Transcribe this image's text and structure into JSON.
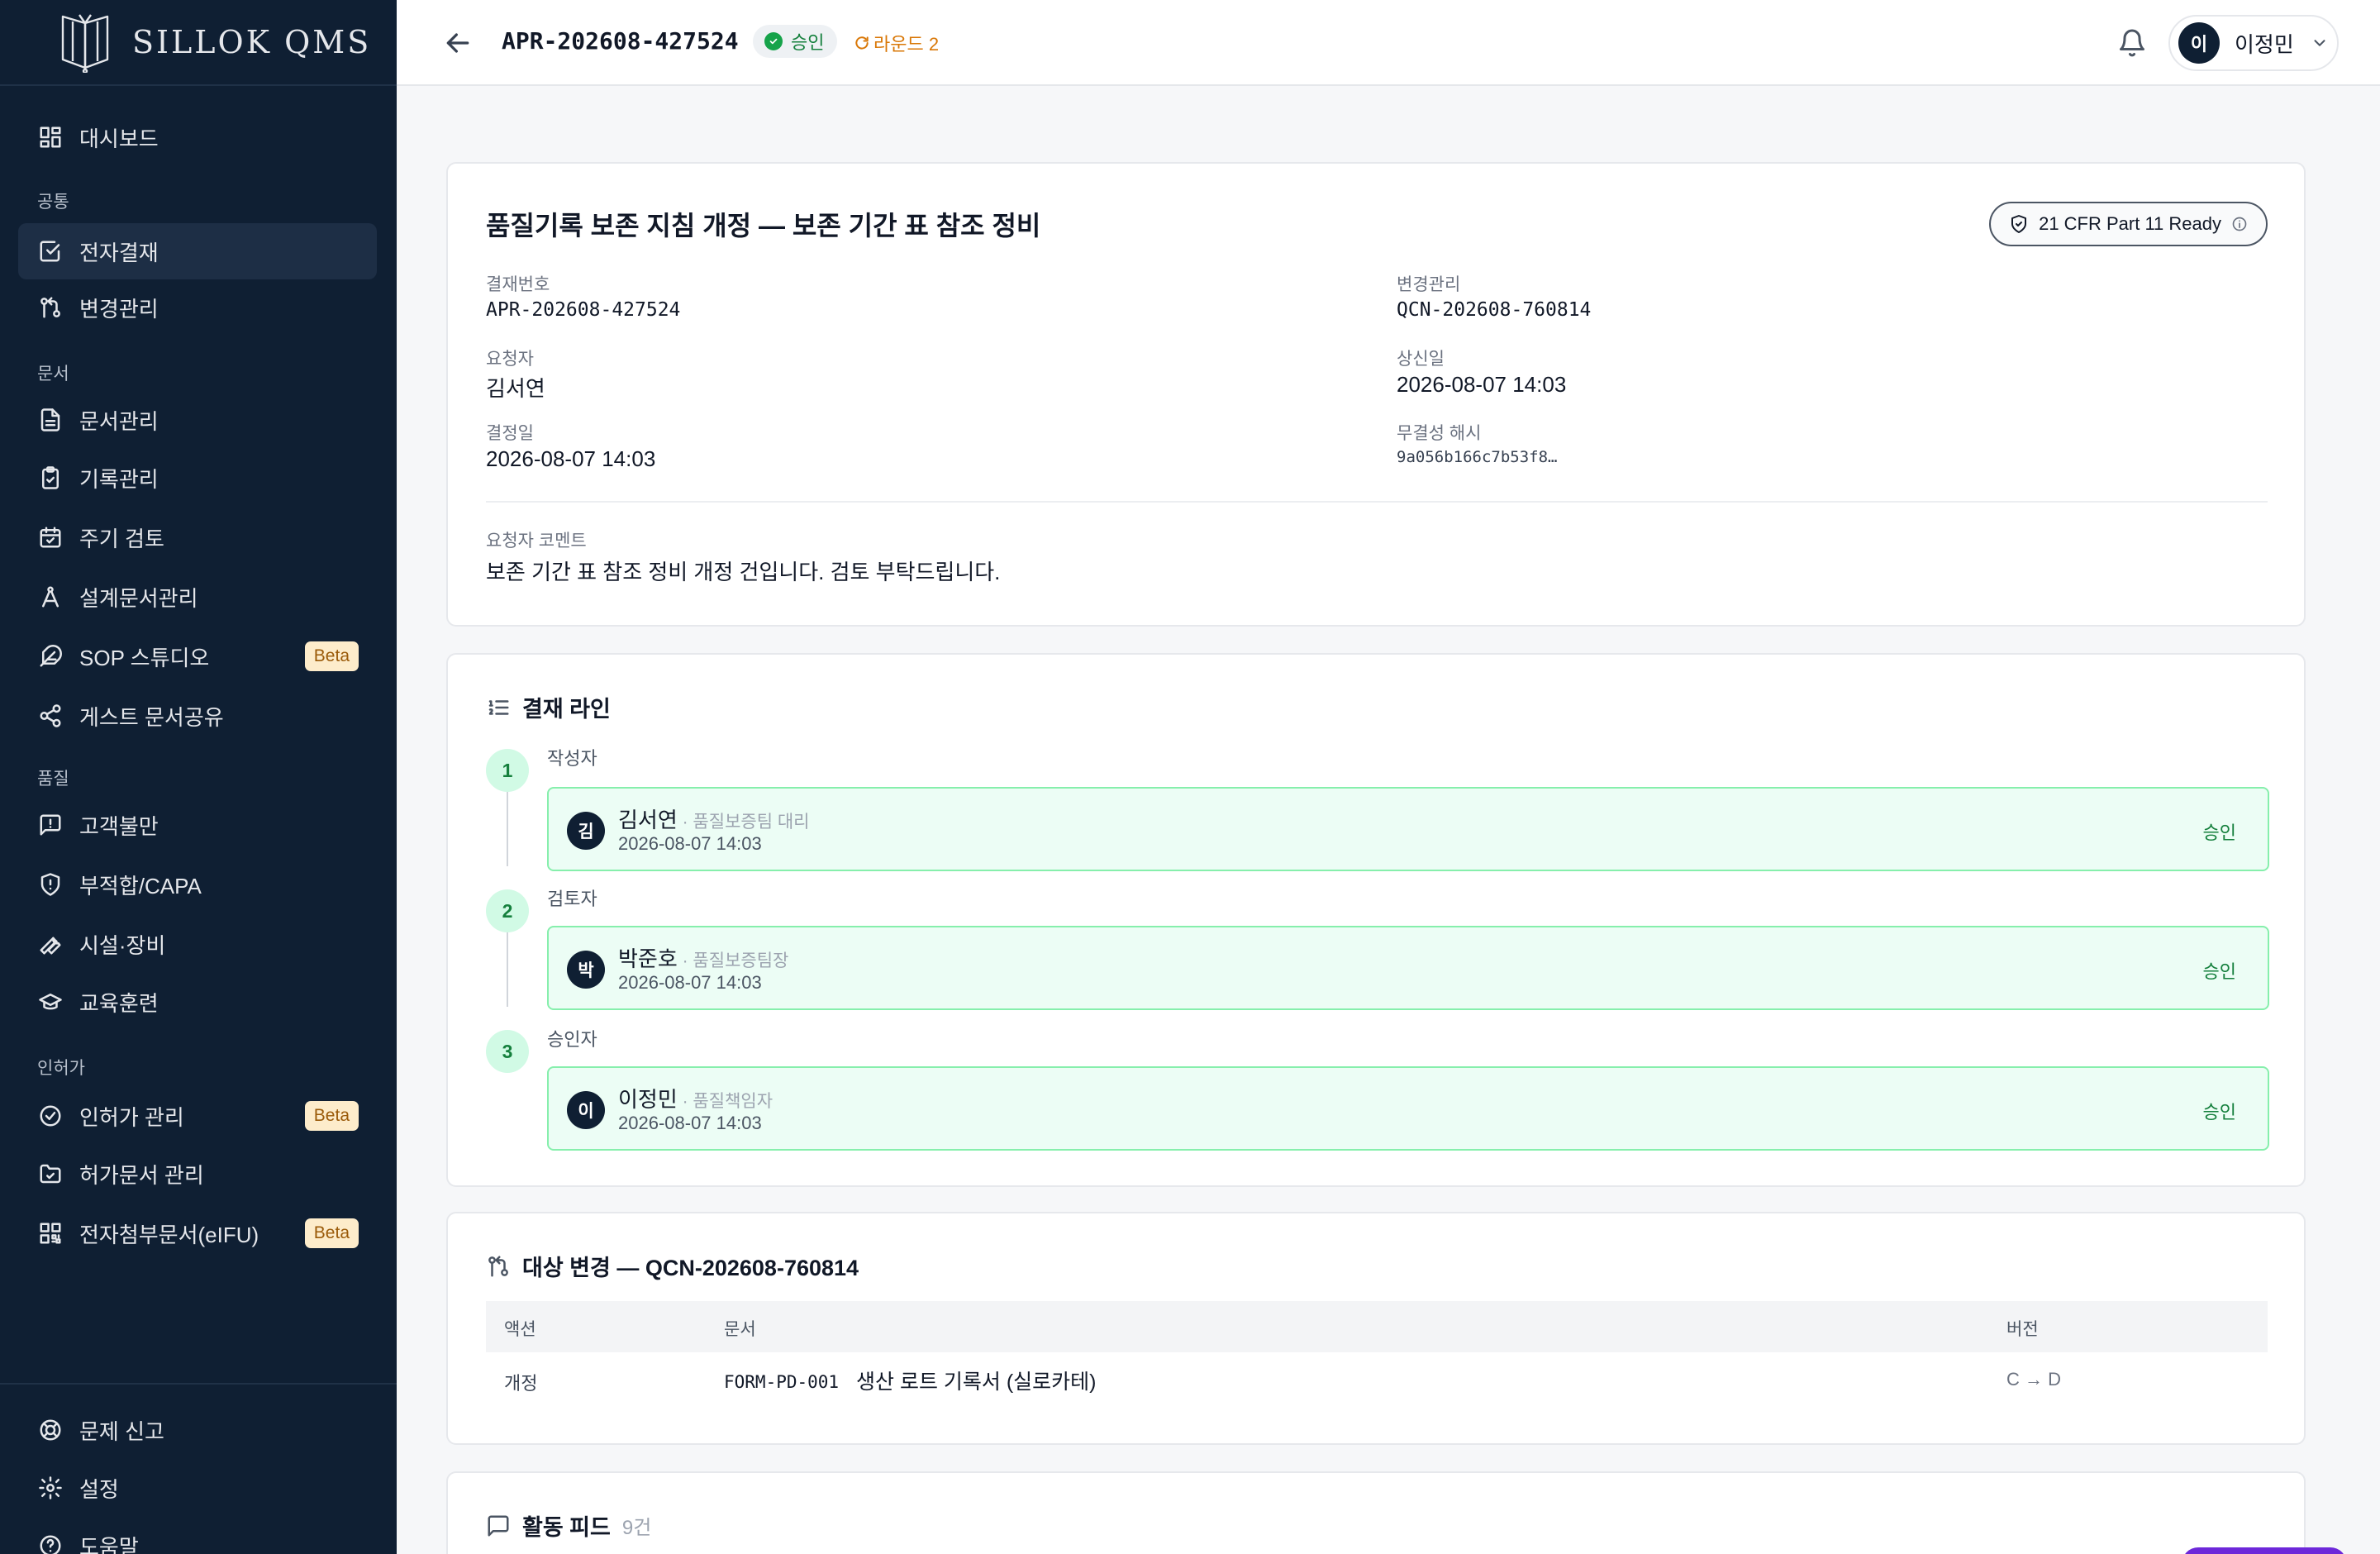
{
  "brand": {
    "name": "SILLOK QMS"
  },
  "sidebar": {
    "items": [
      {
        "id": "dashboard",
        "label": "대시보드",
        "icon": "dashboard-icon"
      },
      {
        "id": "approval",
        "label": "전자결재",
        "icon": "check-square-icon",
        "active": true
      },
      {
        "id": "change",
        "label": "변경관리",
        "icon": "git-compare-icon"
      },
      {
        "id": "docs",
        "label": "문서관리",
        "icon": "file-text-icon"
      },
      {
        "id": "records",
        "label": "기록관리",
        "icon": "clipboard-icon"
      },
      {
        "id": "periodic",
        "label": "주기 검토",
        "icon": "calendar-check-icon"
      },
      {
        "id": "design",
        "label": "설계문서관리",
        "icon": "compass-icon"
      },
      {
        "id": "sop",
        "label": "SOP 스튜디오",
        "icon": "feather-icon",
        "badge": "Beta"
      },
      {
        "id": "guest",
        "label": "게스트 문서공유",
        "icon": "share-icon"
      },
      {
        "id": "complaint",
        "label": "고객불만",
        "icon": "message-alert-icon"
      },
      {
        "id": "capa",
        "label": "부적합/CAPA",
        "icon": "shield-alert-icon"
      },
      {
        "id": "facility",
        "label": "시설·장비",
        "icon": "wrench-icon"
      },
      {
        "id": "training",
        "label": "교육훈련",
        "icon": "graduation-cap-icon"
      },
      {
        "id": "license",
        "label": "인허가 관리",
        "icon": "badge-check-icon",
        "badge": "Beta"
      },
      {
        "id": "permit-docs",
        "label": "허가문서 관리",
        "icon": "folder-check-icon"
      },
      {
        "id": "eifu",
        "label": "전자첨부문서(eIFU)",
        "icon": "qr-code-icon",
        "badge": "Beta"
      }
    ],
    "sections": [
      "공통",
      "문서",
      "품질",
      "인허가"
    ],
    "footer_items": [
      {
        "id": "report",
        "label": "문제 신고",
        "icon": "lifebuoy-icon"
      },
      {
        "id": "settings",
        "label": "설정",
        "icon": "gear-icon"
      },
      {
        "id": "help",
        "label": "도움말",
        "icon": "help-circle-icon"
      }
    ]
  },
  "header": {
    "doc_id": "APR-202608-427524",
    "status": "승인",
    "round": "라운드 2",
    "user": {
      "initial": "이",
      "name": "이정민"
    }
  },
  "summary": {
    "title": "품질기록 보존 지침 개정 — 보존 기간 표 참조 정비",
    "compliance_badge": "21 CFR Part 11 Ready",
    "fields": {
      "approval_no_label": "결재번호",
      "approval_no": "APR-202608-427524",
      "change_label": "변경관리",
      "change_no": "QCN-202608-760814",
      "requester_label": "요청자",
      "requester": "김서연",
      "submitted_label": "상신일",
      "submitted": "2026-08-07 14:03",
      "decided_label": "결정일",
      "decided": "2026-08-07 14:03",
      "hash_label": "무결성 해시",
      "hash": "9a056b166c7b53f8…"
    },
    "comment_label": "요청자 코멘트",
    "comment": "보존 기간 표 참조 정비 개정 건입니다. 검토 부탁드립니다."
  },
  "approval_line": {
    "title": "결재 라인",
    "steps": [
      {
        "num": "1",
        "role": "작성자",
        "initial": "김",
        "name": "김서연",
        "dept": " · 품질보증팀 대리",
        "date": "2026-08-07 14:03",
        "status": "승인"
      },
      {
        "num": "2",
        "role": "검토자",
        "initial": "박",
        "name": "박준호",
        "dept": " · 품질보증팀장",
        "date": "2026-08-07 14:03",
        "status": "승인"
      },
      {
        "num": "3",
        "role": "승인자",
        "initial": "이",
        "name": "이정민",
        "dept": " · 품질책임자",
        "date": "2026-08-07 14:03",
        "status": "승인"
      }
    ]
  },
  "changes": {
    "title": "대상 변경 — QCN-202608-760814",
    "columns": [
      "액션",
      "문서",
      "버전"
    ],
    "rows": [
      {
        "action": "개정",
        "doc_code": "FORM-PD-001",
        "doc_title": "생산 로트 기록서 (실로카테)",
        "version": "C → D"
      }
    ]
  },
  "activity": {
    "title": "활동 피드",
    "count": "9건"
  },
  "colors": {
    "sidebar_bg": "#0f1f33",
    "accent_green": "#15803d",
    "round_orange": "#d97706",
    "beta_bg": "#fdeccb"
  }
}
